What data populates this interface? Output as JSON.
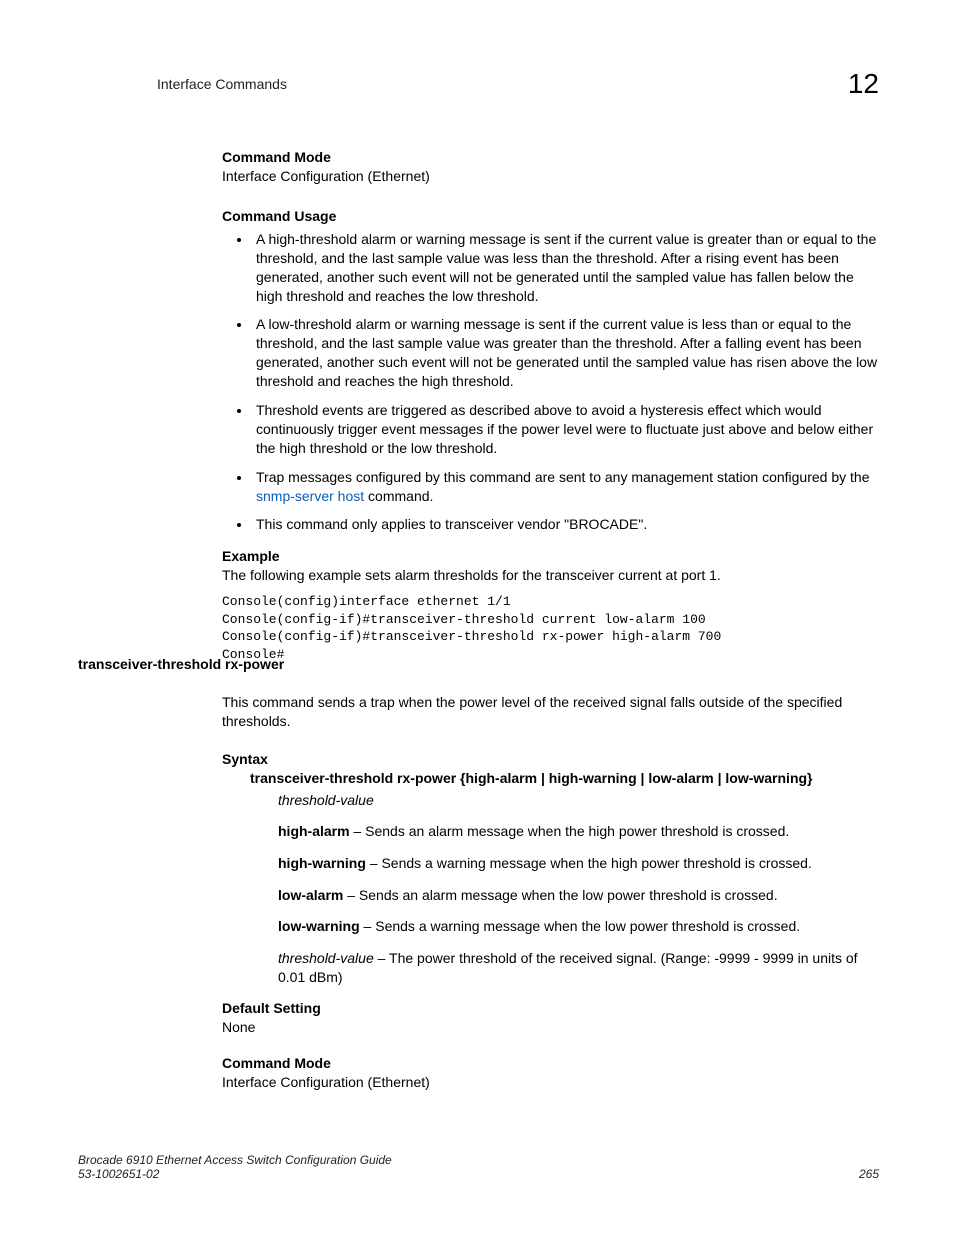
{
  "header": {
    "title": "Interface Commands",
    "chapter": "12"
  },
  "sec1": {
    "cmdModeHead": "Command Mode",
    "cmdModeBody": "Interface Configuration (Ethernet)",
    "cmdUsageHead": "Command Usage",
    "bullets": {
      "b1": "A high-threshold alarm or warning message is sent if the current value is greater than or equal to the threshold, and the last sample value was less than the threshold. After a rising event has been generated, another such event will not be generated until the sampled value has fallen below the high threshold and reaches the low threshold.",
      "b2": "A low-threshold alarm or warning message is sent if the current value is less than or equal to the threshold, and the last sample value was greater than the threshold. After a falling event has been generated, another such event will not be generated until the sampled value has risen above the low threshold and reaches the high threshold.",
      "b3": "Threshold events are triggered as described above to avoid a hysteresis effect which would continuously trigger event messages if the power level were to fluctuate just above and below either the high threshold or the low threshold.",
      "b4a": "Trap messages configured by this command are sent to any management station configured by the ",
      "b4link": "snmp-server host",
      "b4b": " command.",
      "b5": "This command only applies to transceiver vendor \"BROCADE\"."
    },
    "exampleHead": "Example",
    "exampleBody": "The following example sets alarm thresholds for the transceiver current at port 1.",
    "code": "Console(config)interface ethernet 1/1\nConsole(config-if)#transceiver-threshold current low-alarm 100\nConsole(config-if)#transceiver-threshold rx-power high-alarm 700\nConsole#"
  },
  "sec2": {
    "cmdName": "transceiver-threshold rx-power",
    "intro": "This command sends a trap when the power level of the received signal falls outside of the specified thresholds.",
    "syntaxHead": "Syntax",
    "syntaxLine": {
      "cmd": "transceiver-threshold rx-power",
      "opts": " {high-alarm | high-warning | low-alarm | low-warning}",
      "arg": "threshold-value"
    },
    "params": {
      "p1k": "high-alarm",
      "p1v": " – Sends an alarm message when the high power threshold is crossed.",
      "p2k": "high-warning",
      "p2v": " – Sends a warning message when the high power threshold is crossed.",
      "p3k": "low-alarm",
      "p3v": " – Sends an alarm message when the low power threshold is crossed.",
      "p4k": "low-warning",
      "p4v": " – Sends a warning message when the low power threshold is crossed.",
      "p5k": "threshold-value",
      "p5v": " – The power threshold of the received signal. (Range: -9999 - 9999 in units of 0.01 dBm)"
    },
    "defHead": "Default Setting",
    "defBody": "None",
    "cmdModeHead": "Command Mode",
    "cmdModeBody": "Interface Configuration (Ethernet)"
  },
  "footer": {
    "line1": "Brocade 6910 Ethernet Access Switch Configuration Guide",
    "line2": "53-1002651-02",
    "page": "265"
  }
}
